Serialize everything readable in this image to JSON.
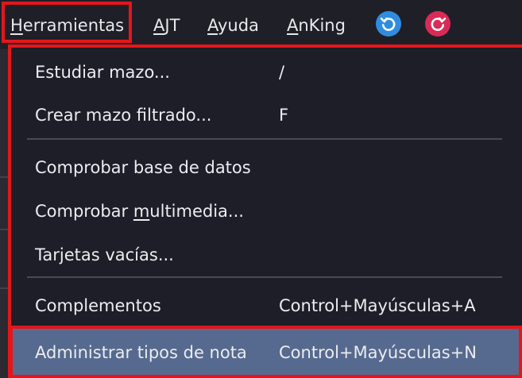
{
  "menubar": {
    "herramientas": {
      "accel": "H",
      "rest": "erramientas"
    },
    "ajt": {
      "accel": "A",
      "rest": "JT"
    },
    "ayuda": {
      "accel": "A",
      "rest": "yuda"
    },
    "anking": {
      "accel": "A",
      "rest": "nKing"
    },
    "sync_icon": "refresh-icon",
    "undo_icon": "undo-icon"
  },
  "dropdown": {
    "items": [
      {
        "label": "Estudiar mazo...",
        "shortcut": "/"
      },
      {
        "label": "Crear mazo filtrado...",
        "shortcut": "F"
      },
      {
        "label": "Comprobar base de datos",
        "shortcut": ""
      },
      {
        "label_before": "Comprobar ",
        "label_accel": "m",
        "label_after": "ultimedia...",
        "shortcut": ""
      },
      {
        "label": "Tarjetas vacías...",
        "shortcut": ""
      },
      {
        "label": "Complementos",
        "shortcut": "Control+Mayúsculas+A"
      },
      {
        "label": "Administrar tipos de nota",
        "shortcut": "Control+Mayúsculas+N"
      }
    ],
    "selected_index": 6
  },
  "colors": {
    "background": "#1f1f27",
    "highlight_box": "#e3161c",
    "selected_row": "#566a8f",
    "sync_blue": "#2f8de0",
    "undo_red": "#d92b58"
  }
}
